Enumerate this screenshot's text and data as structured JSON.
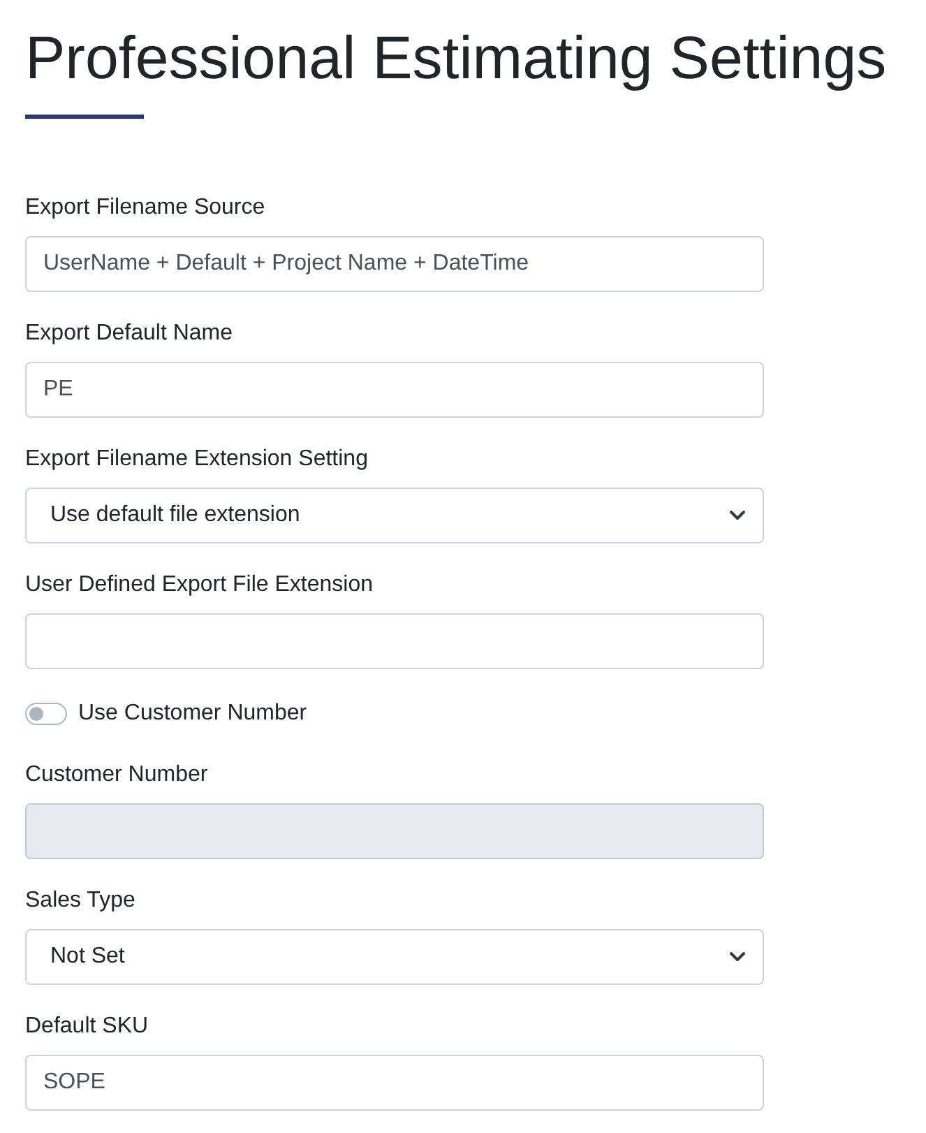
{
  "title": "Professional Estimating Settings",
  "fields": [
    {
      "kind": "text",
      "label": "Export Filename Source",
      "value": "UserName + Default + Project Name + DateTime",
      "disabled": false
    },
    {
      "kind": "text",
      "label": "Export Default Name",
      "value": "PE",
      "disabled": false
    },
    {
      "kind": "select",
      "label": "Export Filename Extension Setting",
      "value": "Use default file extension"
    },
    {
      "kind": "text",
      "label": "User Defined Export File Extension",
      "disabled": false
    },
    {
      "kind": "toggle",
      "label": "Use Customer Number",
      "on": false
    },
    {
      "kind": "text",
      "label": "Customer Number",
      "disabled": true
    },
    {
      "kind": "select",
      "label": "Sales Type",
      "value": "Not Set"
    },
    {
      "kind": "text",
      "label": "Default SKU",
      "value": "SOPE",
      "disabled": false
    }
  ]
}
